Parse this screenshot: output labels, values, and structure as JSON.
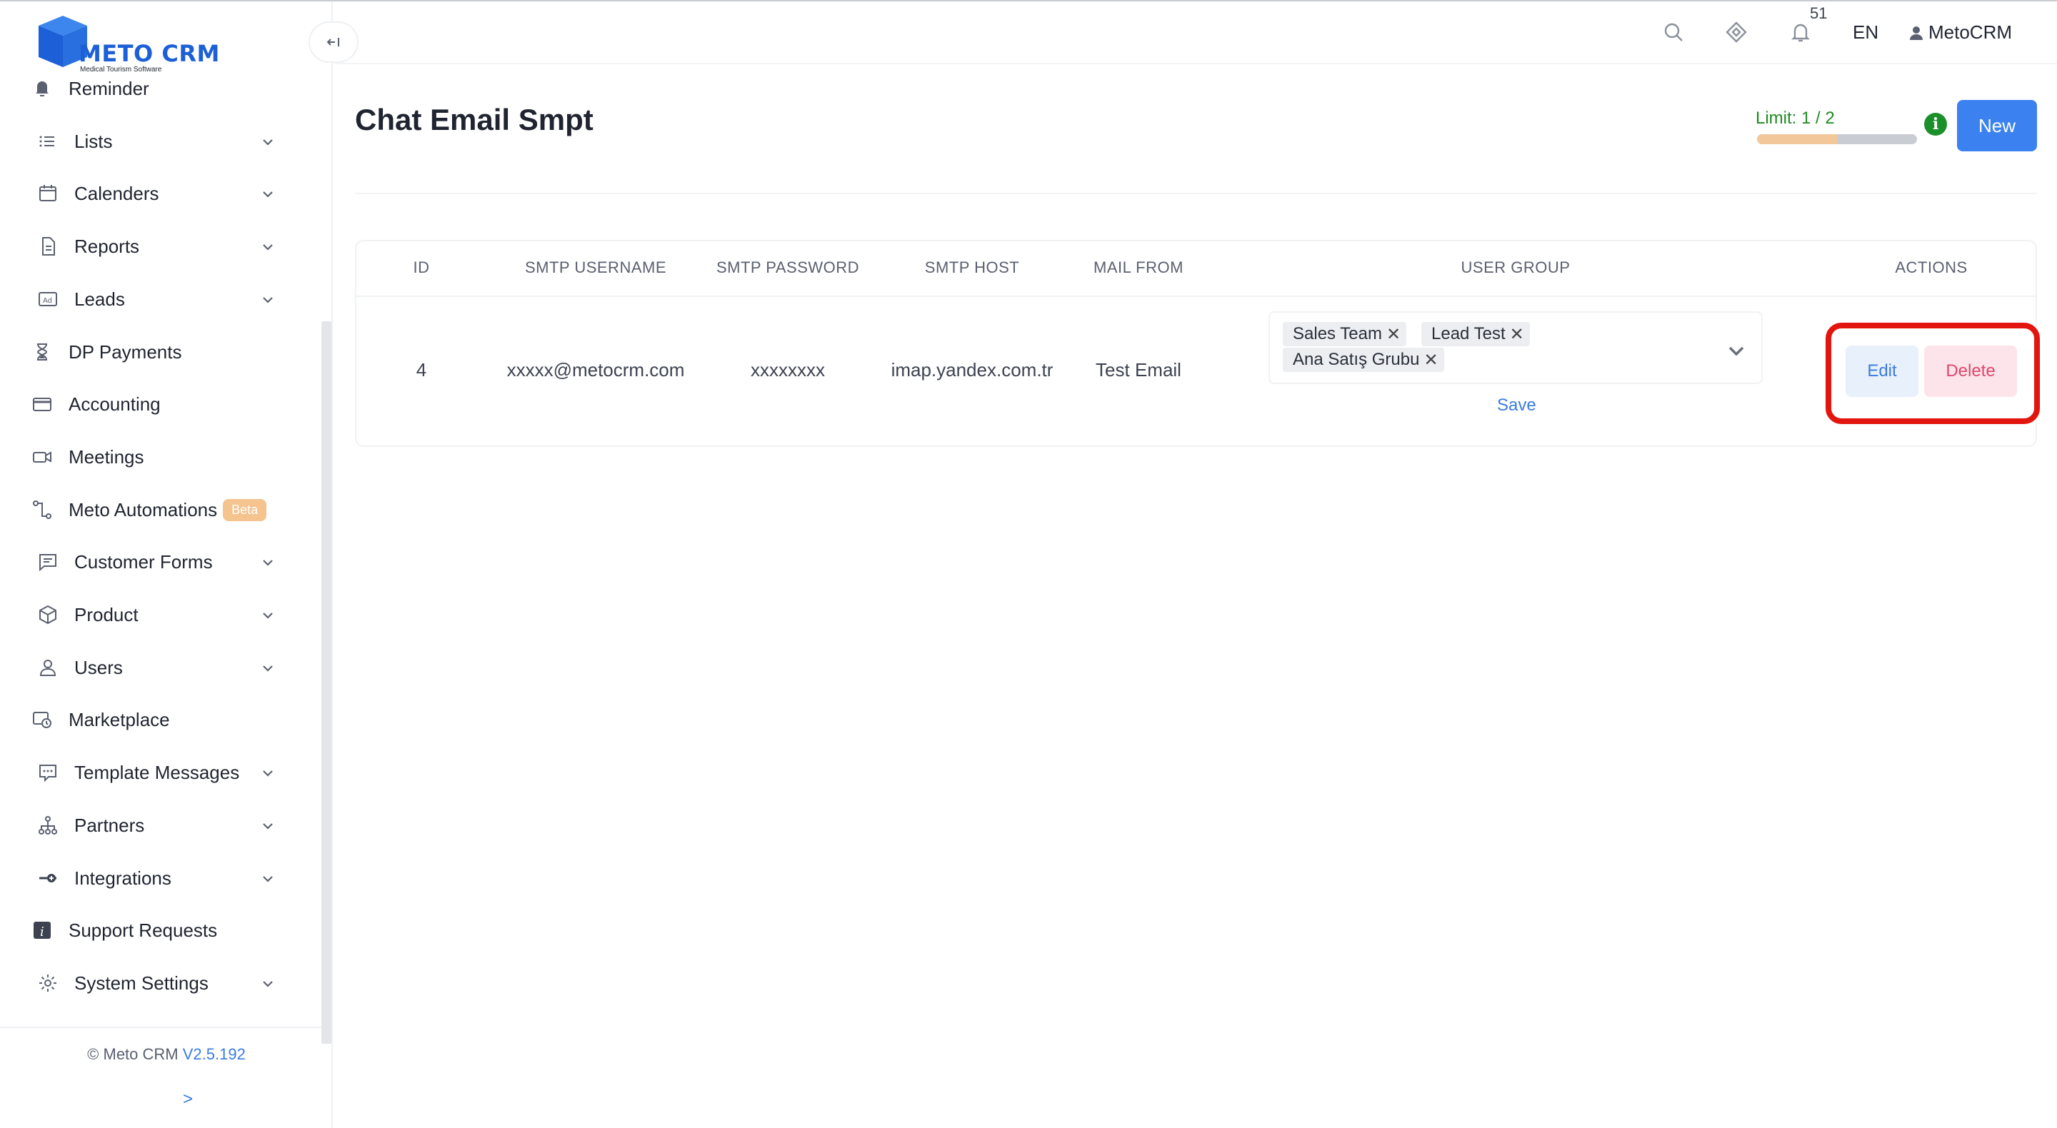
{
  "app": {
    "logo_text": "METO CRM",
    "logo_sub": "Medical Tourism Software",
    "brand_color": "#1d5fd6",
    "accent_color": "#3b82f0"
  },
  "header": {
    "notification_count": "51",
    "language": "EN",
    "user_name": "MetoCRM"
  },
  "sidebar": {
    "items": [
      {
        "label": "Reminder",
        "icon": "bell-icon"
      },
      {
        "label": "Lists",
        "icon": "list-icon",
        "expandable": true
      },
      {
        "label": "Calenders",
        "icon": "calendar-icon",
        "expandable": true
      },
      {
        "label": "Reports",
        "icon": "document-icon",
        "expandable": true
      },
      {
        "label": "Leads",
        "icon": "ad-icon",
        "expandable": true
      },
      {
        "label": "DP Payments",
        "icon": "hourglass-icon"
      },
      {
        "label": "Accounting",
        "icon": "credit-card-icon"
      },
      {
        "label": "Meetings",
        "icon": "video-icon"
      },
      {
        "label": "Meto Automations",
        "icon": "workflow-icon",
        "badge": "Beta"
      },
      {
        "label": "Customer Forms",
        "icon": "chat-form-icon",
        "expandable": true
      },
      {
        "label": "Product",
        "icon": "box-icon",
        "expandable": true
      },
      {
        "label": "Users",
        "icon": "user-icon",
        "expandable": true
      },
      {
        "label": "Marketplace",
        "icon": "marketplace-icon"
      },
      {
        "label": "Template Messages",
        "icon": "message-icon",
        "expandable": true
      },
      {
        "label": "Partners",
        "icon": "network-icon",
        "expandable": true
      },
      {
        "label": "Integrations",
        "icon": "plug-icon",
        "expandable": true
      },
      {
        "label": "Support Requests",
        "icon": "info-square-icon"
      },
      {
        "label": "System Settings",
        "icon": "gear-icon",
        "expandable": true
      }
    ],
    "copyright": "© Meto CRM",
    "version": "V2.5.192",
    "expand_label": ">"
  },
  "main": {
    "title": "Chat Email Smpt",
    "limit_text": "Limit: 1 / 2",
    "limit_used": 1,
    "limit_total": 2,
    "new_button": "New",
    "table": {
      "columns": [
        "ID",
        "SMTP USERNAME",
        "SMTP PASSWORD",
        "SMTP HOST",
        "MAIL FROM",
        "USER GROUP",
        "ACTIONS"
      ],
      "rows": [
        {
          "id": "4",
          "username": "xxxxx@metocrm.com",
          "password": "xxxxxxxx",
          "host": "imap.yandex.com.tr",
          "mail_from": "Test Email",
          "user_groups": [
            "Sales Team",
            "Lead Test",
            "Ana Satış Grubu"
          ],
          "save_label": "Save",
          "edit_label": "Edit",
          "delete_label": "Delete"
        }
      ]
    }
  }
}
